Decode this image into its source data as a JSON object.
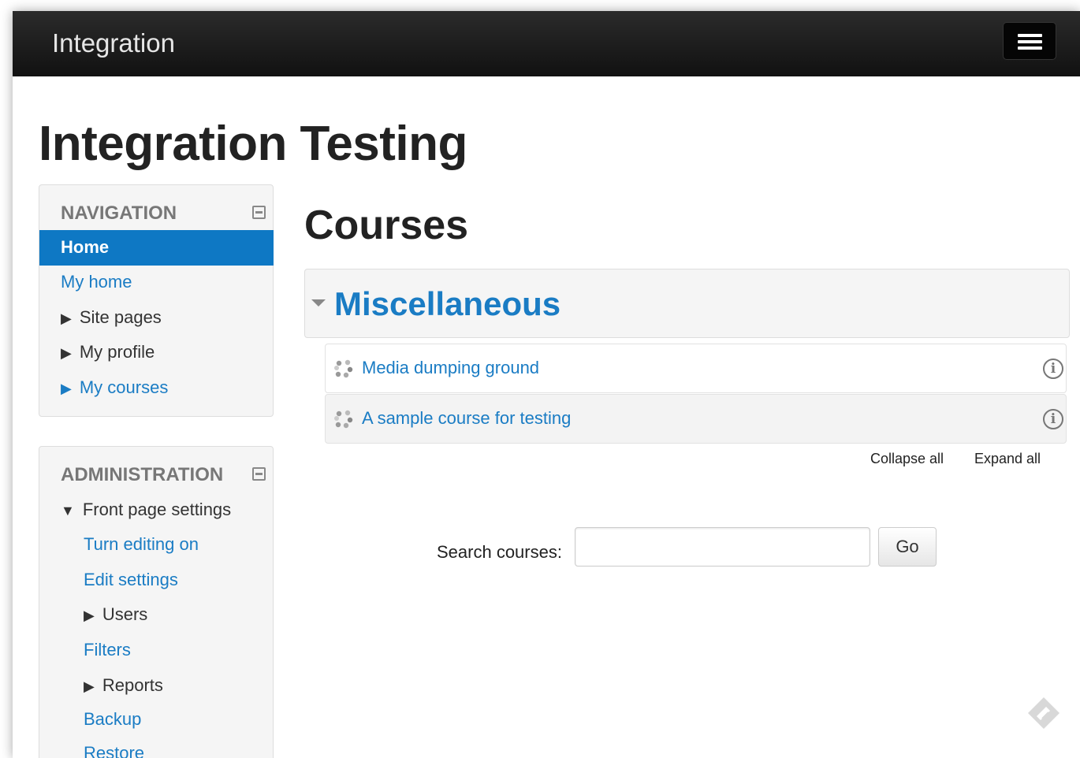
{
  "navbar": {
    "brand": "Integration",
    "menu_icon": "hamburger-menu-icon"
  },
  "page": {
    "title": "Integration Testing"
  },
  "navigation": {
    "title": "NAVIGATION",
    "items": [
      {
        "label": "Home",
        "active": true
      },
      {
        "label": "My home",
        "link": true
      },
      {
        "label": "Site pages",
        "expandable": true
      },
      {
        "label": "My profile",
        "expandable": true
      },
      {
        "label": "My courses",
        "expandable": true,
        "link": true
      }
    ]
  },
  "administration": {
    "title": "ADMINISTRATION",
    "items": [
      {
        "label": "Front page settings",
        "expanded": true
      },
      {
        "label": "Turn editing on",
        "link": true
      },
      {
        "label": "Edit settings",
        "link": true
      },
      {
        "label": "Users",
        "expandable": true
      },
      {
        "label": "Filters",
        "link": true
      },
      {
        "label": "Reports",
        "expandable": true
      },
      {
        "label": "Backup",
        "link": true
      },
      {
        "label": "Restore",
        "link": true
      }
    ]
  },
  "main": {
    "heading": "Courses",
    "category": "Miscellaneous",
    "courses": [
      {
        "name": "Media dumping ground"
      },
      {
        "name": "A sample course for testing"
      }
    ],
    "collapse_all": "Collapse all",
    "expand_all": "Expand all",
    "search_label": "Search courses:",
    "search_value": "",
    "go_label": "Go"
  },
  "colors": {
    "link": "#1a7cc4",
    "active": "#0e78c4",
    "navbar": "#1a1a1a"
  }
}
